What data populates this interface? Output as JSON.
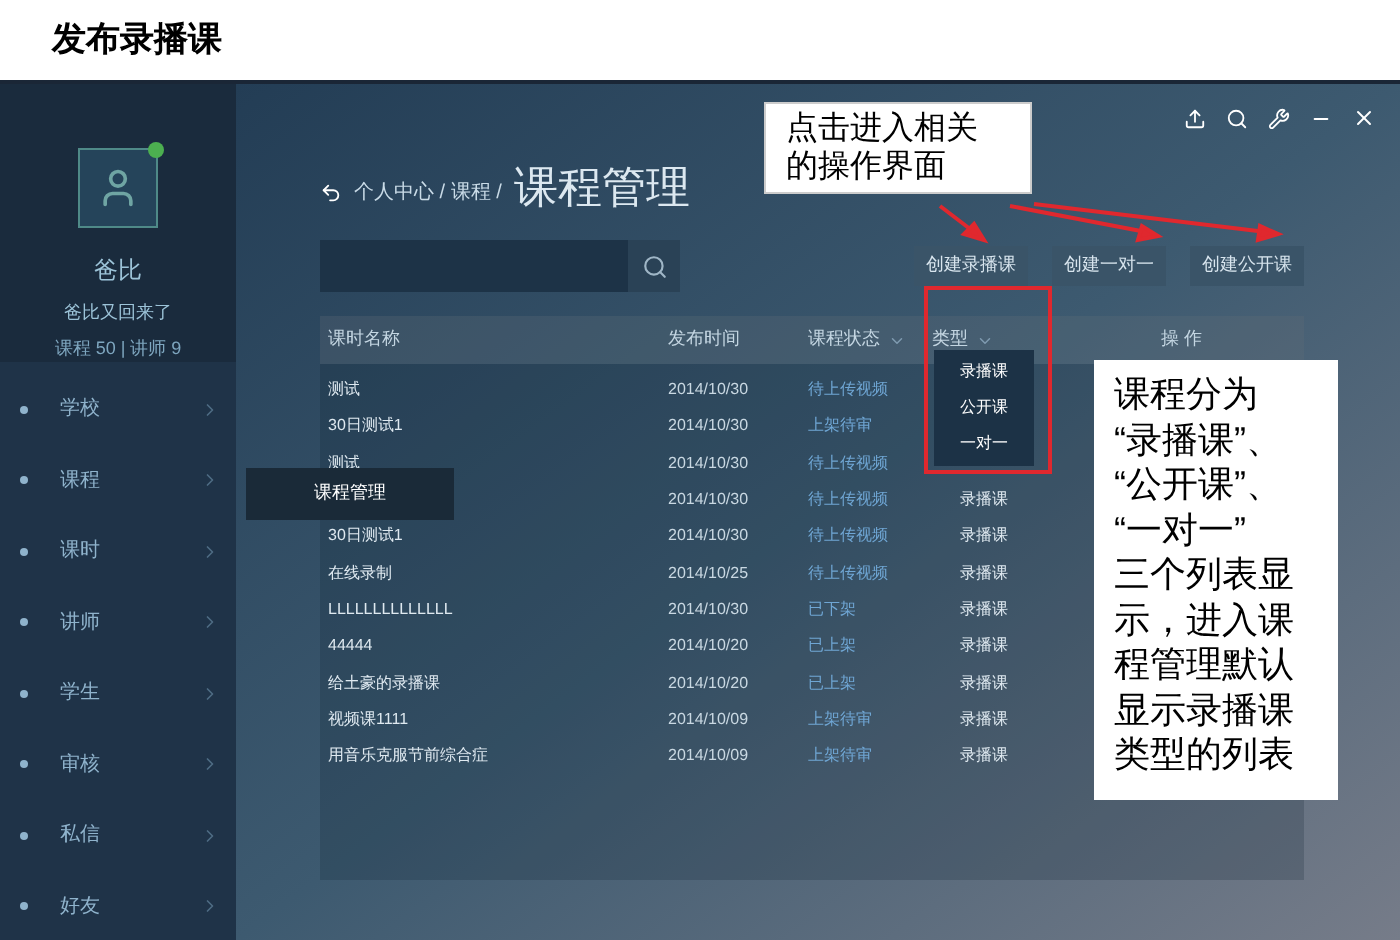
{
  "page_title": "发布录播课",
  "profile": {
    "name": "爸比",
    "status": "爸比又回来了",
    "stats": "课程 50 | 讲师 9",
    "online": true
  },
  "sidebar": {
    "items": [
      {
        "label": "学校"
      },
      {
        "label": "课程",
        "submenu": [
          "课程管理"
        ]
      },
      {
        "label": "课时"
      },
      {
        "label": "讲师"
      },
      {
        "label": "学生"
      },
      {
        "label": "审核"
      },
      {
        "label": "私信"
      },
      {
        "label": "好友"
      }
    ]
  },
  "breadcrumb": "个人中心 / 课程 /",
  "title": "课程管理",
  "buttons": [
    "创建录播课",
    "创建一对一",
    "创建公开课"
  ],
  "table": {
    "columns": [
      {
        "label": "课时名称",
        "dropdown": false
      },
      {
        "label": "发布时间",
        "dropdown": false
      },
      {
        "label": "课程状态",
        "dropdown": true
      },
      {
        "label": "类型",
        "dropdown": true
      },
      {
        "label": "操 作",
        "dropdown": false
      }
    ],
    "type_menu": {
      "expanded": true,
      "options": [
        "录播课",
        "公开课",
        "一对一"
      ]
    },
    "rows": [
      {
        "name": "测试",
        "date": "2014/10/30",
        "status": "待上传视频"
      },
      {
        "name": "30日测试1",
        "date": "2014/10/30",
        "status": "上架待审"
      },
      {
        "name": "测试",
        "date": "2014/10/30",
        "status": "待上传视频"
      },
      {
        "date": "2014/10/30",
        "status": "待上传视频",
        "type": "录播课"
      },
      {
        "name": "30日测试1",
        "date": "2014/10/30",
        "status": "待上传视频",
        "type": "录播课"
      },
      {
        "name": "在线录制",
        "date": "2014/10/25",
        "status": "待上传视频",
        "type": "录播课"
      },
      {
        "name": "LLLLLLLLLLLLLL",
        "date": "2014/10/30",
        "status": "已下架",
        "type": "录播课"
      },
      {
        "name": "44444",
        "date": "2014/10/20",
        "status": "已上架",
        "type": "录播课"
      },
      {
        "name": "给土豪的录播课",
        "date": "2014/10/20",
        "status": "已上架",
        "type": "录播课"
      },
      {
        "name": "视频课1111",
        "date": "2014/10/09",
        "status": "上架待审",
        "type": "录播课"
      },
      {
        "name": "用音乐克服节前综合症",
        "date": "2014/10/09",
        "status": "上架待审",
        "type": "录播课"
      }
    ]
  },
  "annotations": [
    {
      "lines": [
        "点击进入相关",
        "的操作界面"
      ]
    },
    {
      "lines": [
        "课程分为",
        "“录播课”、",
        "“公开课”、",
        "“一对一”",
        "三个列表显",
        "示，进入课",
        "程管理默认",
        "显示录播课",
        "类型的列表"
      ]
    }
  ]
}
